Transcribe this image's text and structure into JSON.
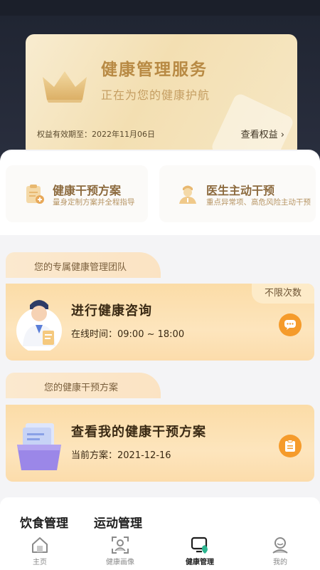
{
  "vip_card": {
    "title": "健康管理服务",
    "subtitle": "正在为您的健康护航",
    "expire": "权益有效期至：2022年11月06日",
    "link": "查看权益 ›"
  },
  "features": [
    {
      "title": "健康干预方案",
      "desc": "量身定制方案并全程指导"
    },
    {
      "title": "医生主动干预",
      "desc": "重点异常项、高危风险主动干预"
    }
  ],
  "team_section": {
    "tab_label": "您的专属健康管理团队",
    "badge": "不限次数",
    "title": "进行健康咨询",
    "subtitle": "在线时间：09:00 ~ 18:00"
  },
  "plan_section": {
    "tab_label": "您的健康干预方案",
    "title": "查看我的健康干预方案",
    "subtitle": "当前方案：2021-12-16"
  },
  "categories": [
    "饮食管理",
    "运动管理"
  ],
  "tabbar": [
    {
      "label": "主页",
      "icon": "home-icon"
    },
    {
      "label": "健康画像",
      "icon": "portrait-scan-icon"
    },
    {
      "label": "健康管理",
      "icon": "health-manage-icon",
      "active": true
    },
    {
      "label": "我的",
      "icon": "user-icon"
    }
  ],
  "colors": {
    "accent_orange": "#f59b2b",
    "gold_text": "#b88a44",
    "dark_bg": "#1f2431",
    "active_dot": "#2bb58f"
  }
}
